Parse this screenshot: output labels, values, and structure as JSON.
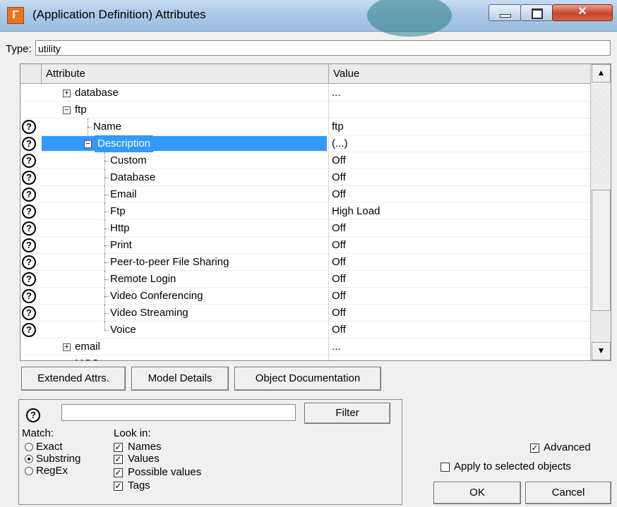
{
  "window": {
    "title": "(Application Definition) Attributes",
    "controls": [
      "minimize-icon",
      "maximize-icon",
      "close-icon"
    ]
  },
  "type_field": {
    "label": "Type:",
    "value": "utility"
  },
  "grid": {
    "headers": [
      "Attribute",
      "Value"
    ],
    "rows": [
      {
        "label": "database",
        "value": "...",
        "expander": "plus",
        "help": false
      },
      {
        "label": "ftp",
        "value": "",
        "expander": "minus",
        "help": false
      },
      {
        "label": "Name",
        "value": "ftp",
        "help": true
      },
      {
        "label": "Description",
        "value": "(...)",
        "expander": "minus",
        "help": true,
        "selected": true
      },
      {
        "label": "Custom",
        "value": "Off",
        "help": true
      },
      {
        "label": "Database",
        "value": "Off",
        "help": true
      },
      {
        "label": "Email",
        "value": "Off",
        "help": true
      },
      {
        "label": "Ftp",
        "value": "High Load",
        "help": true
      },
      {
        "label": "Http",
        "value": "Off",
        "help": true
      },
      {
        "label": "Print",
        "value": "Off",
        "help": true
      },
      {
        "label": "Peer-to-peer File Sharing",
        "value": "Off",
        "help": true
      },
      {
        "label": "Remote Login",
        "value": "Off",
        "help": true
      },
      {
        "label": "Video Conferencing",
        "value": "Off",
        "help": true
      },
      {
        "label": "Video Streaming",
        "value": "Off",
        "help": true
      },
      {
        "label": "Voice",
        "value": "Off",
        "help": true
      },
      {
        "label": "email",
        "value": "...",
        "expander": "plus",
        "help": false
      },
      {
        "label": "MOS",
        "value": "",
        "expander": "plus",
        "help": false
      }
    ]
  },
  "buttons": {
    "extended_attrs": "Extended Attrs.",
    "model_details": "Model Details",
    "object_documentation": "Object Documentation",
    "filter": "Filter",
    "ok": "OK",
    "cancel": "Cancel"
  },
  "filter": {
    "search_value": "",
    "match_label": "Match:",
    "match_options": [
      "Exact",
      "Substring",
      "RegEx"
    ],
    "match_selected": "Substring",
    "look_in_label": "Look in:",
    "look_in_options": [
      "Names",
      "Values",
      "Possible values",
      "Tags"
    ],
    "look_in_checked": [
      true,
      true,
      true,
      true
    ]
  },
  "options": {
    "advanced_label": "Advanced",
    "advanced_checked": true,
    "apply_label": "Apply to selected objects",
    "apply_checked": false
  }
}
